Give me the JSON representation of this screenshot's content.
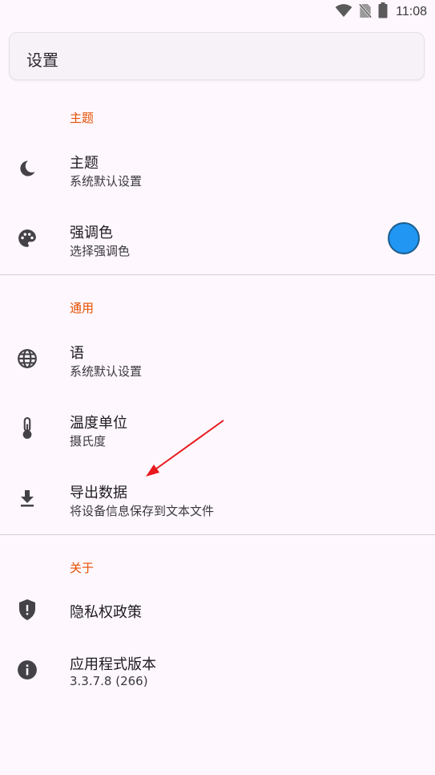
{
  "status_bar": {
    "time": "11:08",
    "icons": [
      "wifi-icon",
      "no-sim-icon",
      "battery-icon"
    ]
  },
  "search": {
    "title": "设置"
  },
  "sections": {
    "theme": {
      "header": "主题",
      "items": [
        {
          "icon": "moon-icon",
          "title": "主题",
          "subtitle": "系统默认设置"
        },
        {
          "icon": "palette-icon",
          "title": "强调色",
          "subtitle": "选择强调色"
        }
      ]
    },
    "general": {
      "header": "通用",
      "items": [
        {
          "icon": "globe-icon",
          "title": "语",
          "subtitle": "系统默认设置"
        },
        {
          "icon": "thermometer-icon",
          "title": "温度单位",
          "subtitle": "摄氏度"
        },
        {
          "icon": "download-icon",
          "title": "导出数据",
          "subtitle": "将设备信息保存到文本文件"
        }
      ]
    },
    "about": {
      "header": "关于",
      "items": [
        {
          "icon": "shield-icon",
          "title": "隐私权政策"
        },
        {
          "icon": "info-icon",
          "title": "应用程式版本",
          "subtitle": "3.3.7.8 (266)"
        }
      ]
    }
  },
  "colors": {
    "background": "#fef7fe",
    "section_header": "#e65100",
    "accent_swatch": "#2196f3",
    "annotation_arrow": "#e8191c"
  }
}
